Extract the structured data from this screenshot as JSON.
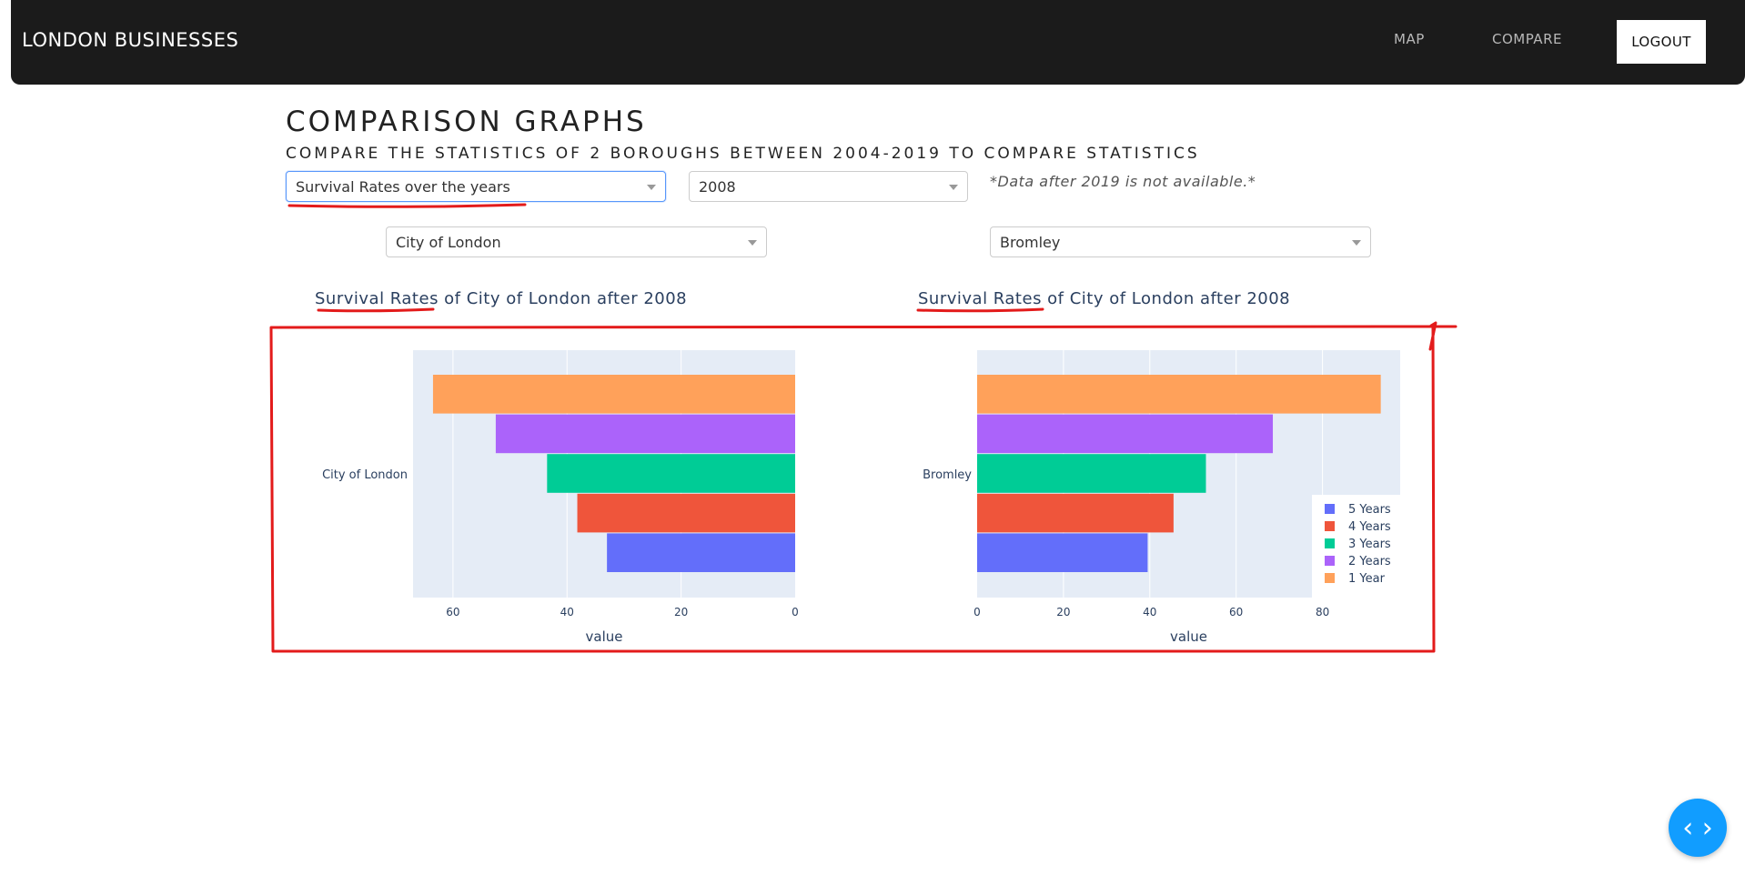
{
  "navbar": {
    "brand": "LONDON BUSINESSES",
    "links": [
      "MAP",
      "COMPARE"
    ],
    "logout": "LOGOUT",
    "background": "#1b1b1b"
  },
  "page": {
    "title": "COMPARISON GRAPHS",
    "subtitle": "COMPARE THE STATISTICS OF 2 BOROUGHS BETWEEN 2004-2019 TO COMPARE STATISTICS",
    "note": "*Data after 2019 is not available.*"
  },
  "controls": {
    "statistic": "Survival Rates over the years",
    "year": "2008",
    "borough_left": "City of London",
    "borough_right": "Bromley"
  },
  "graph_titles": {
    "left": "Survival Rates of City of London after 2008",
    "right": "Survival Rates of City of London after 2008"
  },
  "colors": {
    "1 Year": "#ffa15a",
    "2 Years": "#ab63fa",
    "3 Years": "#00cc96",
    "4 Years": "#ef553b",
    "5 Years": "#636efa",
    "annotation": "#e31b1b",
    "fab": "#119dff",
    "plot_bg": "#e5ecf6"
  },
  "chart_data": [
    {
      "type": "bar",
      "orientation": "horizontal",
      "category": "City of London",
      "series": [
        {
          "name": "1 Year",
          "value": 63.5
        },
        {
          "name": "2 Years",
          "value": 52.5
        },
        {
          "name": "3 Years",
          "value": 43.5
        },
        {
          "name": "4 Years",
          "value": 38.2
        },
        {
          "name": "5 Years",
          "value": 33
        }
      ],
      "xlabel": "value",
      "xlim": [
        67,
        0
      ],
      "xticks": [
        60,
        40,
        20,
        0
      ],
      "reversed": true,
      "legend": false
    },
    {
      "type": "bar",
      "orientation": "horizontal",
      "category": "Bromley",
      "series": [
        {
          "name": "1 Year",
          "value": 93.5
        },
        {
          "name": "2 Years",
          "value": 68.5
        },
        {
          "name": "3 Years",
          "value": 53
        },
        {
          "name": "4 Years",
          "value": 45.5
        },
        {
          "name": "5 Years",
          "value": 39.5
        }
      ],
      "xlabel": "value",
      "xlim": [
        0,
        98
      ],
      "xticks": [
        0,
        20,
        40,
        60,
        80
      ],
      "reversed": false,
      "legend": true,
      "legend_position": "bottom-right",
      "legend_items": [
        "5 Years",
        "4 Years",
        "3 Years",
        "2 Years",
        "1 Year"
      ]
    }
  ],
  "fab": {
    "icon": "code-icon",
    "glyph": "‹ ›"
  }
}
